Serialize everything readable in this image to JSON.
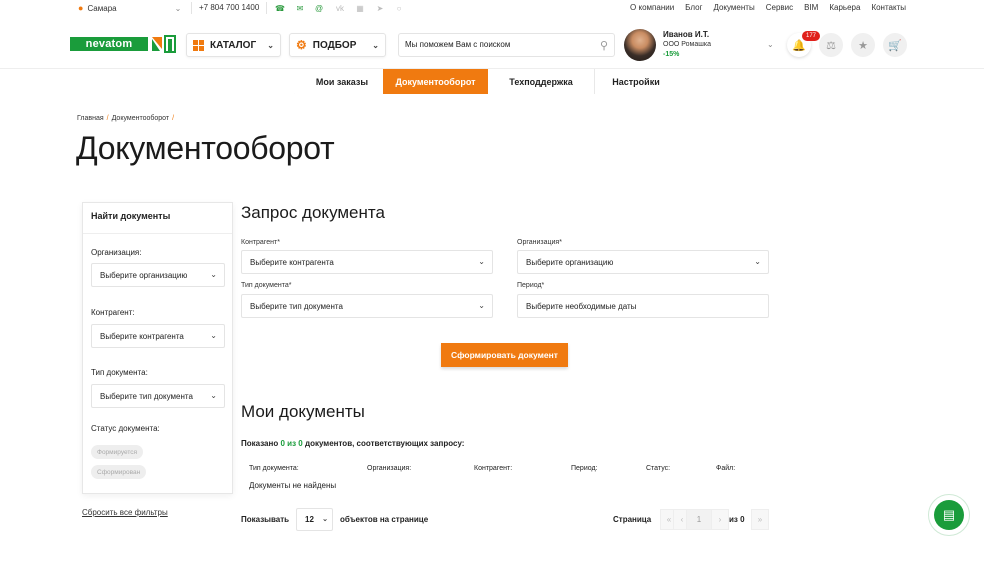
{
  "topbar": {
    "city": "Самара",
    "phone": "+7 804 700 1400",
    "links": [
      "О компании",
      "Блог",
      "Документы",
      "Сервис",
      "BIM",
      "Карьера",
      "Контакты"
    ]
  },
  "header": {
    "logo_text": "nevatom",
    "catalog_label": "КАТАЛОГ",
    "podbor_label": "ПОДБОР",
    "search_placeholder": "Мы поможем Вам с поиском",
    "user": {
      "name": "Иванов И.Т.",
      "org": "ООО Ромашка",
      "discount": "-15%"
    },
    "notifications_count": "177"
  },
  "tabs": [
    {
      "label": "Мои заказы",
      "active": false
    },
    {
      "label": "Документооборот",
      "active": true
    },
    {
      "label": "Техподдержка",
      "active": false
    },
    {
      "label": "Настройки",
      "active": false
    }
  ],
  "breadcrumb": {
    "home": "Главная",
    "current": "Документооборот"
  },
  "page_title": "Документооборот",
  "sidebar": {
    "title": "Найти документы",
    "org_label": "Организация:",
    "org_value": "Выберите организацию",
    "contr_label": "Контрагент:",
    "contr_value": "Выберите контрагента",
    "type_label": "Тип документа:",
    "type_value": "Выберите тип документа",
    "status_label": "Статус документа:",
    "statuses": [
      "Формируется",
      "Сформирован"
    ],
    "reset": "Сбросить все фильтры"
  },
  "request": {
    "title": "Запрос документа",
    "contr_label": "Контрагент*",
    "contr_value": "Выберите контрагента",
    "org_label": "Организация*",
    "org_value": "Выберите организацию",
    "type_label": "Тип документа*",
    "type_value": "Выберите тип документа",
    "period_label": "Период*",
    "period_value": "Выберите необходимые даты",
    "submit": "Сформировать документ"
  },
  "docs": {
    "title": "Мои документы",
    "shown_prefix": "Показано",
    "shown_a": "0",
    "shown_of": "из",
    "shown_b": "0",
    "shown_suffix": "документов, соответствующих запросу:",
    "columns": [
      "Тип документа:",
      "Организация:",
      "Контрагент:",
      "Период:",
      "Статус:",
      "Файл:"
    ],
    "empty": "Документы не найдены",
    "per_page_label": "Показывать",
    "per_page_value": "12",
    "per_page_suffix": "объектов на странице",
    "page_label": "Страница",
    "page_value": "1",
    "page_of": "из 0"
  },
  "colors": {
    "accent": "#f07a10",
    "brand": "#1a9c3b",
    "badge": "#e0211b"
  }
}
